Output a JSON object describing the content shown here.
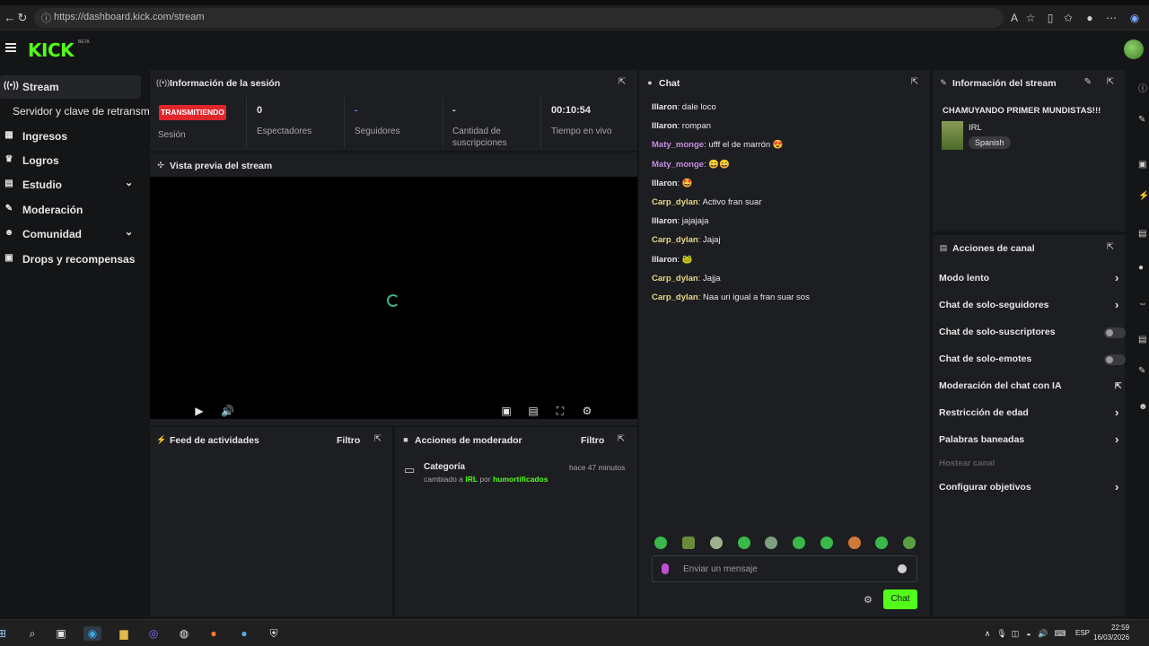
{
  "browser": {
    "url": "https://dashboard.kick.com/stream"
  },
  "header": {
    "logo": "KICK",
    "beta": "BETA"
  },
  "sidebar": {
    "items": [
      {
        "label": "Stream",
        "icon": "broadcast-icon"
      },
      {
        "label": "Servidor y clave de retransmisión",
        "icon": ""
      },
      {
        "label": "Ingresos",
        "icon": "bank-icon"
      },
      {
        "label": "Logros",
        "icon": "trophy-icon"
      },
      {
        "label": "Estudio",
        "icon": "studio-icon"
      },
      {
        "label": "Moderación",
        "icon": "wrench-icon"
      },
      {
        "label": "Comunidad",
        "icon": "people-icon"
      },
      {
        "label": "Drops y recompensas",
        "icon": "gift-icon"
      }
    ]
  },
  "session": {
    "title": "Información de la sesión",
    "live_badge": "TRANSMITIENDO",
    "session_label": "Sesión",
    "viewers_value": "0",
    "viewers_label": "Espectadores",
    "followers_value": "-",
    "followers_label": "Seguidores",
    "subs_value": "-",
    "subs_label_1": "Cantidad de",
    "subs_label_2": "suscripciones",
    "live_time_value": "00:10:54",
    "live_time_label": "Tiempo en vivo"
  },
  "preview": {
    "title": "Vista previa del stream"
  },
  "feed": {
    "title": "Feed de actividades",
    "filter": "Filtro"
  },
  "modactions": {
    "title": "Acciones de moderador",
    "filter": "Filtro",
    "entry_title": "Categoría",
    "entry_time": "hace 47 minutos",
    "entry_prefix": "cambiado a",
    "entry_category": "IRL",
    "entry_by": "por",
    "entry_user": "humortificados"
  },
  "chat": {
    "title": "Chat",
    "input_placeholder": "Enviar un mensaje",
    "send_label": "Chat",
    "messages": [
      {
        "user": "Illaron",
        "text": " dale loco",
        "color": "#e6e6e6"
      },
      {
        "user": "Illaron",
        "text": " rompan",
        "color": "#e6e6e6"
      },
      {
        "user": "Maty_monge",
        "text": " ufff el de marrón 😍",
        "color": "#c58de0"
      },
      {
        "user": "Maty_monge",
        "text": " 😄😄",
        "color": "#c58de0"
      },
      {
        "user": "Illaron",
        "text": " 🤩",
        "color": "#e6e6e6"
      },
      {
        "user": "Carp_dylan",
        "text": " Activo fran suar",
        "color": "#e8d88a"
      },
      {
        "user": "Illaron",
        "text": " jajajaja",
        "color": "#e6e6e6"
      },
      {
        "user": "Carp_dylan",
        "text": " Jajaj",
        "color": "#e8d88a"
      },
      {
        "user": "Illaron",
        "text": " 🐸",
        "color": "#e6e6e6"
      },
      {
        "user": "Carp_dylan",
        "text": " Jajja",
        "color": "#e8d88a"
      },
      {
        "user": "Carp_dylan",
        "text": " Naa uri igual a fran suar sos",
        "color": "#e8d88a"
      }
    ]
  },
  "streaminfo": {
    "title": "Información del stream",
    "stream_title": "CHAMUYANDO PRIMER MUNDISTAS!!!",
    "category": "IRL",
    "language": "Spanish"
  },
  "channel": {
    "title": "Acciones de canal",
    "rows": [
      {
        "label": "Modo lento",
        "control": "chevron"
      },
      {
        "label": "Chat de solo-seguidores",
        "control": "chevron"
      },
      {
        "label": "Chat de solo-suscriptores",
        "control": "toggle"
      },
      {
        "label": "Chat de solo-emotes",
        "control": "toggle"
      },
      {
        "label": "Moderación del chat con IA",
        "control": "external"
      },
      {
        "label": "Restricción de edad",
        "control": "chevron"
      },
      {
        "label": "Palabras baneadas",
        "control": "chevron"
      },
      {
        "label": "Hostear canal",
        "control": "disabled"
      },
      {
        "label": "Configurar objetivos",
        "control": "chevron"
      }
    ]
  },
  "taskbar": {
    "lang": "ESP",
    "time": "22:59",
    "date": "16/03/2026"
  },
  "colors": {
    "accent": "#53fc18",
    "live": "#e0262c",
    "panel": "#1d1e21",
    "background": "#141517"
  }
}
